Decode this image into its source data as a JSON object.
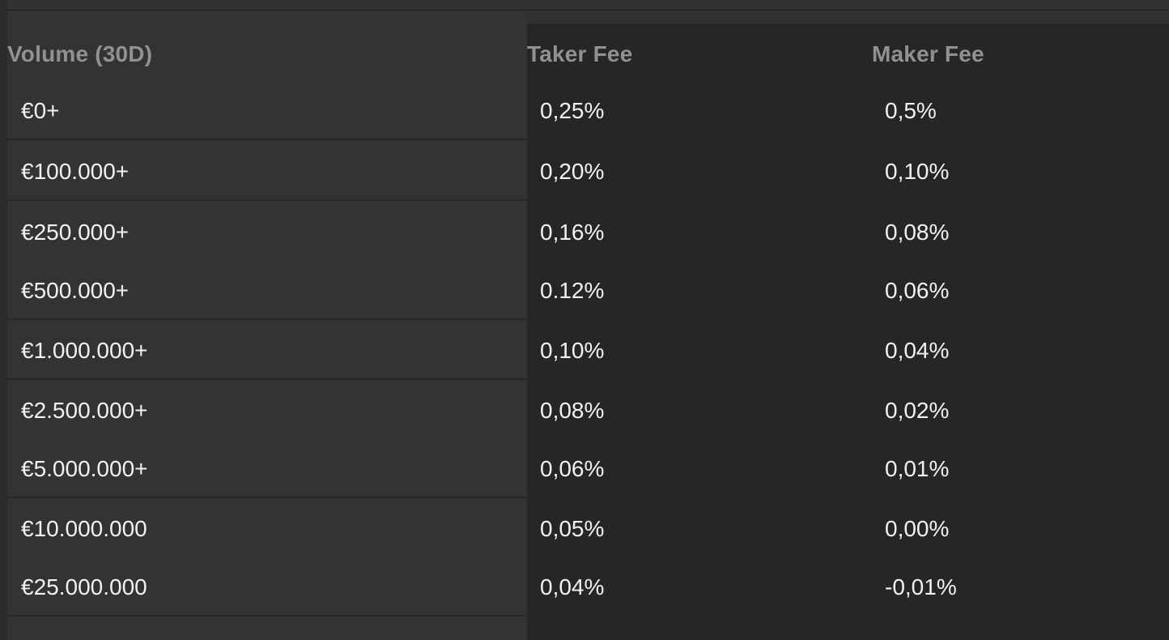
{
  "table": {
    "headers": {
      "volume": "Volume (30D)",
      "taker": "Taker Fee",
      "maker": "Maker Fee"
    },
    "rows": [
      {
        "volume": "€0+",
        "taker": "0,25%",
        "maker": "0,5%"
      },
      {
        "volume": "€100.000+",
        "taker": "0,20%",
        "maker": "0,10%"
      },
      {
        "volume": "€250.000+",
        "taker": "0,16%",
        "maker": "0,08%"
      },
      {
        "volume": "€500.000+",
        "taker": "0.12%",
        "maker": "0,06%"
      },
      {
        "volume": "€1.000.000+",
        "taker": "0,10%",
        "maker": "0,04%"
      },
      {
        "volume": "€2.500.000+",
        "taker": "0,08%",
        "maker": "0,02%"
      },
      {
        "volume": "€5.000.000+",
        "taker": "0,06%",
        "maker": "0,01%"
      },
      {
        "volume": "€10.000.000",
        "taker": "0,05%",
        "maker": "0,00%"
      },
      {
        "volume": "€25.000.000",
        "taker": "0,04%",
        "maker": "-0,01%"
      }
    ]
  },
  "colors": {
    "background": "#262626",
    "volume_column_bg": "#323433",
    "header_text": "#8f9193",
    "cell_text": "#f1f1f1"
  }
}
